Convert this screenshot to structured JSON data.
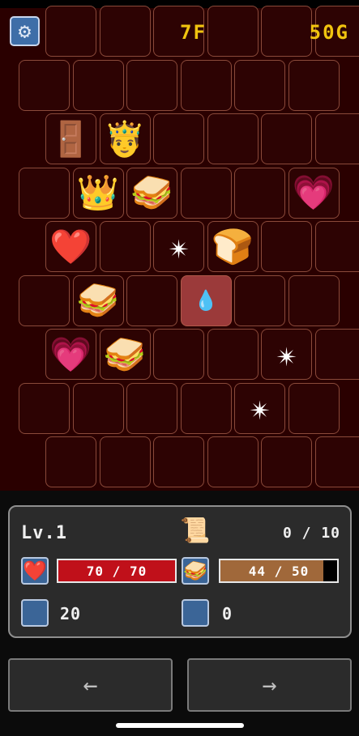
{
  "hud": {
    "floor": "7F",
    "gold": "50G",
    "settings_icon": "gear-icon"
  },
  "board": {
    "rows": [
      {
        "offset": 1,
        "cells": [
          {
            "i": ""
          },
          {
            "i": ""
          },
          {
            "i": ""
          },
          {
            "i": ""
          },
          {
            "i": ""
          },
          {
            "i": ""
          }
        ]
      },
      {
        "offset": 0,
        "cells": [
          {
            "i": ""
          },
          {
            "i": ""
          },
          {
            "i": ""
          },
          {
            "i": ""
          },
          {
            "i": ""
          },
          {
            "i": ""
          }
        ]
      },
      {
        "offset": 1,
        "cells": [
          {
            "i": "🚪"
          },
          {
            "i": "🤴"
          },
          {
            "i": ""
          },
          {
            "i": ""
          },
          {
            "i": ""
          },
          {
            "i": ""
          }
        ]
      },
      {
        "offset": 0,
        "cells": [
          {
            "i": ""
          },
          {
            "i": "👑"
          },
          {
            "i": "🥪"
          },
          {
            "i": ""
          },
          {
            "i": ""
          },
          {
            "i": "💗"
          }
        ]
      },
      {
        "offset": 1,
        "cells": [
          {
            "i": "❤️"
          },
          {
            "i": ""
          },
          {
            "i": "✴"
          },
          {
            "i": "🍞"
          },
          {
            "i": ""
          },
          {
            "i": ""
          }
        ]
      },
      {
        "offset": 0,
        "cells": [
          {
            "i": ""
          },
          {
            "i": "🥪"
          },
          {
            "i": ""
          },
          {
            "i": "💧",
            "h": true
          },
          {
            "i": ""
          },
          {
            "i": ""
          }
        ]
      },
      {
        "offset": 1,
        "cells": [
          {
            "i": "💗"
          },
          {
            "i": "🥪"
          },
          {
            "i": ""
          },
          {
            "i": ""
          },
          {
            "i": "✴"
          },
          {
            "i": ""
          }
        ]
      },
      {
        "offset": 0,
        "cells": [
          {
            "i": ""
          },
          {
            "i": ""
          },
          {
            "i": ""
          },
          {
            "i": ""
          },
          {
            "i": "✴"
          },
          {
            "i": ""
          }
        ]
      },
      {
        "offset": 1,
        "cells": [
          {
            "i": ""
          },
          {
            "i": ""
          },
          {
            "i": ""
          },
          {
            "i": ""
          },
          {
            "i": ""
          },
          {
            "i": ""
          }
        ]
      }
    ]
  },
  "status": {
    "level": "Lv.1",
    "exp": "0 / 10",
    "hp": {
      "text": "70 / 70",
      "value": 70,
      "max": 70,
      "color": "#c0101a"
    },
    "food": {
      "text": "44 / 50",
      "value": 44,
      "max": 50,
      "color": "#a0683a"
    },
    "attack": "20",
    "defense": "0"
  },
  "nav": {
    "left": "←",
    "right": "→"
  }
}
